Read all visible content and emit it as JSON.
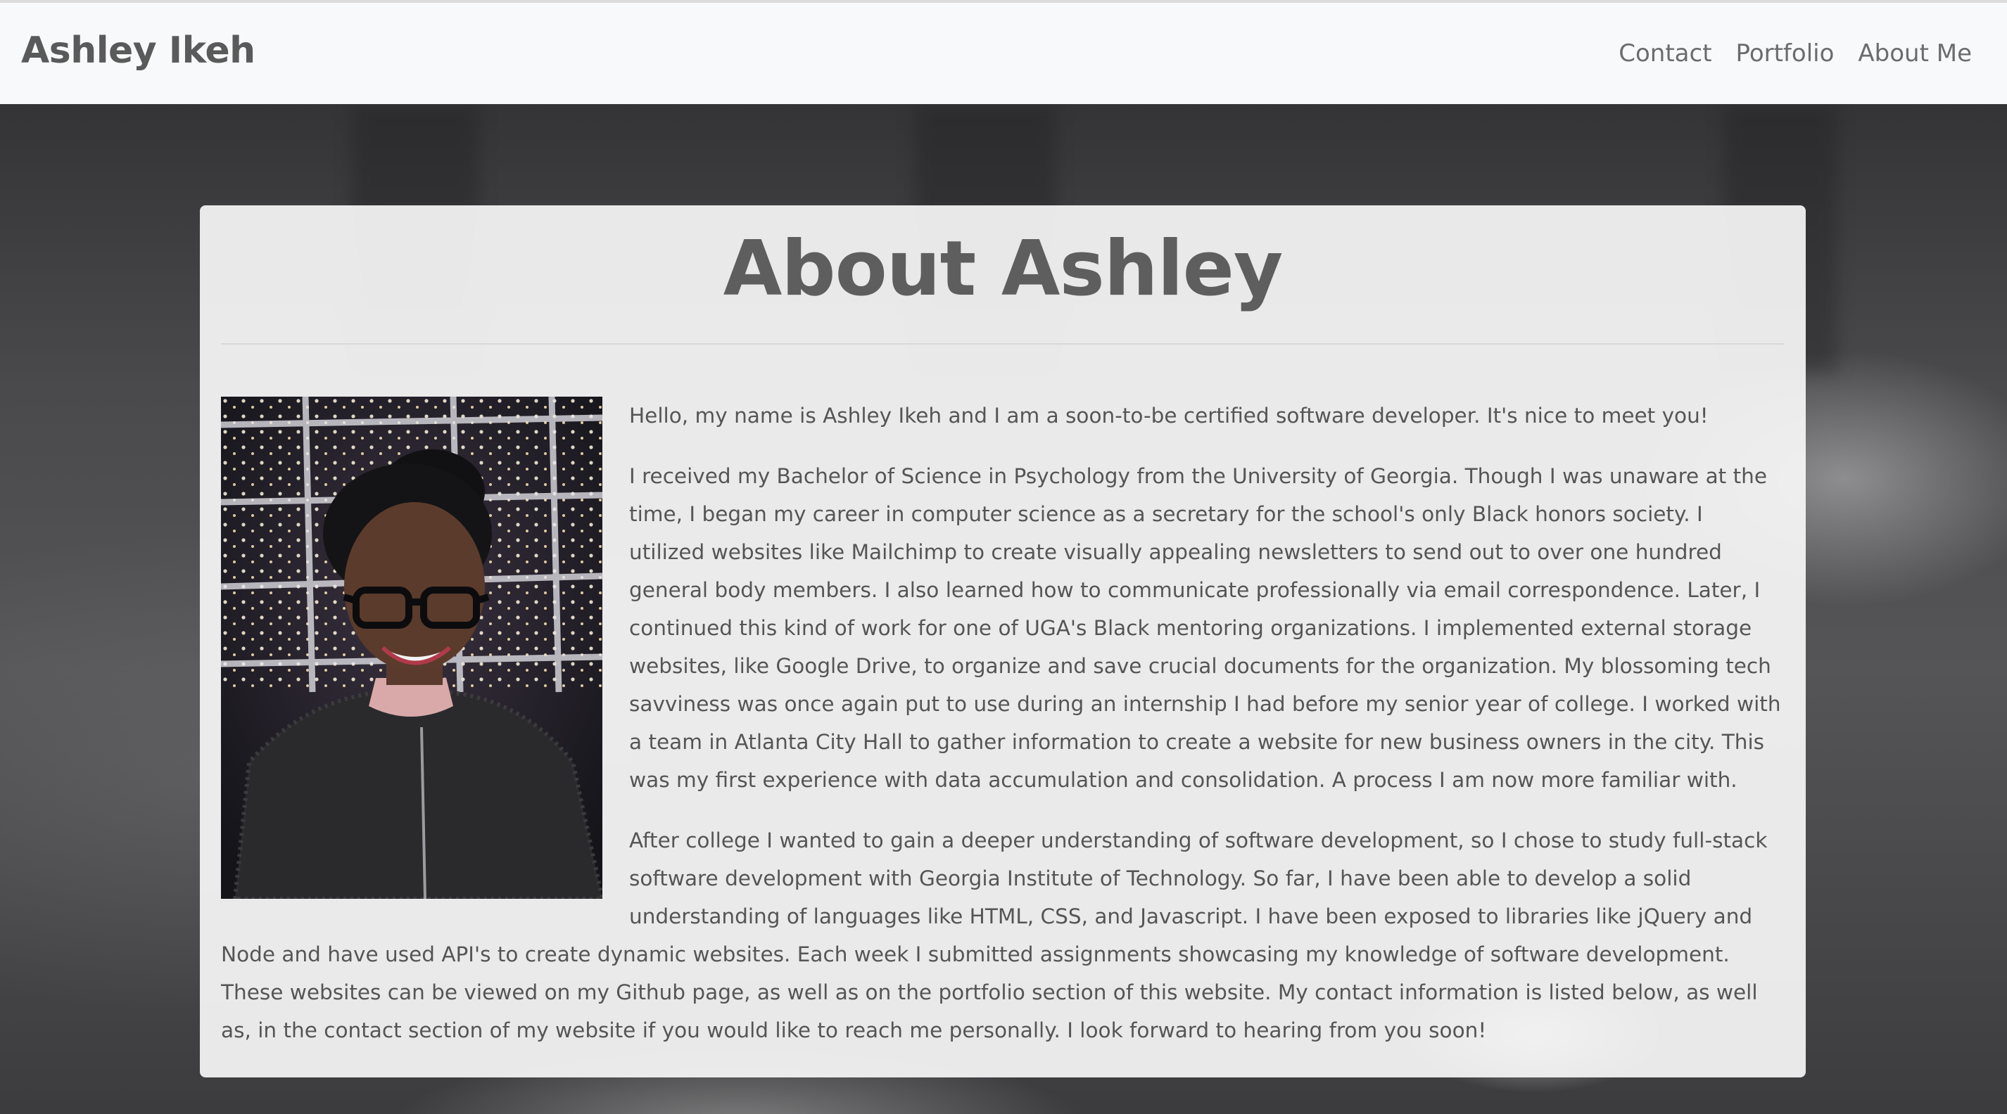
{
  "navbar": {
    "brand": "Ashley Ikeh",
    "links": [
      "Contact",
      "Portfolio",
      "About Me"
    ]
  },
  "about": {
    "title": "About Ashley",
    "photo_alt": "Portrait of Ashley Ikeh smiling in front of string lights",
    "paragraphs": [
      "Hello, my name is Ashley Ikeh and I am a soon-to-be certified software developer. It's nice to meet you!",
      "I received my Bachelor of Science in Psychology from the University of Georgia. Though I was unaware at the time, I began my career in computer science as a secretary for the school's only Black honors society. I utilized websites like Mailchimp to create visually appealing newsletters to send out to over one hundred general body members. I also learned how to communicate professionally via email correspondence. Later, I continued this kind of work for one of UGA's Black mentoring organizations. I implemented external storage websites, like Google Drive, to organize and save crucial documents for the organization. My blossoming tech savviness was once again put to use during an internship I had before my senior year of college. I worked with a team in Atlanta City Hall to gather information to create a website for new business owners in the city. This was my first experience with data accumulation and consolidation. A process I am now more familiar with.",
      "After college I wanted to gain a deeper understanding of software development, so I chose to study full-stack software development with Georgia Institute of Technology. So far, I have been able to develop a solid understanding of languages like HTML, CSS, and Javascript. I have been exposed to libraries like jQuery and Node and have used API's to create dynamic websites. Each week I submitted assignments showcasing my knowledge of software development. These websites can be viewed on my Github page, as well as on the portfolio section of this website. My contact information is listed below, as well as, in the contact section of my website if you would like to reach me personally. I look forward to hearing from you soon!"
    ]
  }
}
